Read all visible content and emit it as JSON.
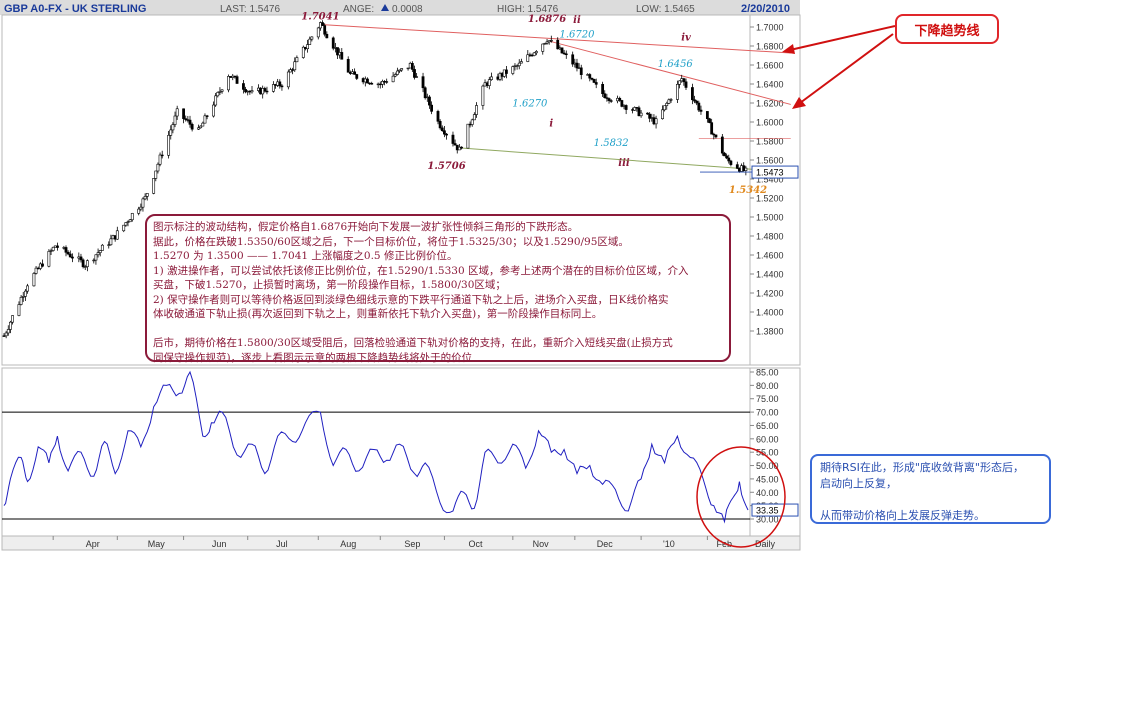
{
  "header": {
    "symbol": "GBP A0-FX - UK STERLING",
    "last": "LAST: 1.5476",
    "change_label": "ANGE:",
    "change_value": "0.0008",
    "high": "HIGH: 1.5476",
    "low": "LOW: 1.5465",
    "date": "2/20/2010"
  },
  "colors": {
    "candle": "#000000",
    "resistance_line": "#e06060",
    "support_line": "#90a860",
    "rsi_line": "#2020c0",
    "annotation_red": "#8b1a3a",
    "annotation_cyan": "#20a0c8",
    "circle": "#d01010"
  },
  "chart_data": [
    {
      "type": "candlestick",
      "title": "GBP A0-FX - UK STERLING",
      "x_months": [
        "Apr",
        "May",
        "Jun",
        "Jul",
        "Aug",
        "Sep",
        "Oct",
        "Nov",
        "Dec",
        "'10",
        "Feb",
        "Daily"
      ],
      "ylim": [
        1.36,
        1.71
      ],
      "y_ticks": [
        "1.7000",
        "1.6800",
        "1.6600",
        "1.6400",
        "1.6200",
        "1.6000",
        "1.5800",
        "1.5600",
        "1.5400",
        "1.5200",
        "1.5000",
        "1.4800",
        "1.4600",
        "1.4400",
        "1.4200",
        "1.4000",
        "1.3800"
      ],
      "last_value_label": "1.5473",
      "approx_close_path": [
        {
          "date": "2009-03-09",
          "value": 1.375
        },
        {
          "date": "2009-03-20",
          "value": 1.43
        },
        {
          "date": "2009-04-02",
          "value": 1.47
        },
        {
          "date": "2009-04-16",
          "value": 1.45
        },
        {
          "date": "2009-04-30",
          "value": 1.48
        },
        {
          "date": "2009-05-14",
          "value": 1.52
        },
        {
          "date": "2009-05-29",
          "value": 1.61
        },
        {
          "date": "2009-06-08",
          "value": 1.59
        },
        {
          "date": "2009-06-22",
          "value": 1.65
        },
        {
          "date": "2009-07-03",
          "value": 1.63
        },
        {
          "date": "2009-07-17",
          "value": 1.64
        },
        {
          "date": "2009-08-04",
          "value": 1.7041
        },
        {
          "date": "2009-08-18",
          "value": 1.65
        },
        {
          "date": "2009-09-01",
          "value": 1.64
        },
        {
          "date": "2009-09-15",
          "value": 1.66
        },
        {
          "date": "2009-09-28",
          "value": 1.6
        },
        {
          "date": "2009-10-08",
          "value": 1.5706
        },
        {
          "date": "2009-10-20",
          "value": 1.64
        },
        {
          "date": "2009-11-05",
          "value": 1.66
        },
        {
          "date": "2009-11-18",
          "value": 1.6876
        },
        {
          "date": "2009-12-01",
          "value": 1.66
        },
        {
          "date": "2009-12-14",
          "value": 1.63
        },
        {
          "date": "2009-12-31",
          "value": 1.61
        },
        {
          "date": "2010-01-08",
          "value": 1.6
        },
        {
          "date": "2010-01-20",
          "value": 1.6456
        },
        {
          "date": "2010-02-01",
          "value": 1.6
        },
        {
          "date": "2010-02-10",
          "value": 1.56
        },
        {
          "date": "2010-02-19",
          "value": 1.5476
        }
      ],
      "annotations": [
        {
          "text": "1.7041",
          "date": "2009-08-04",
          "value": 1.708,
          "color": "red"
        },
        {
          "text": "1.6876",
          "date": "2009-11-18",
          "value": 1.7055,
          "color": "red"
        },
        {
          "text": "ii",
          "date": "2009-12-02",
          "value": 1.704,
          "color": "red"
        },
        {
          "text": "1.6720",
          "date": "2009-12-02",
          "value": 1.689,
          "color": "cyan"
        },
        {
          "text": "iv",
          "date": "2010-01-22",
          "value": 1.686,
          "color": "red"
        },
        {
          "text": "1.6456",
          "date": "2010-01-17",
          "value": 1.658,
          "color": "cyan"
        },
        {
          "text": "1.6270",
          "date": "2009-11-10",
          "value": 1.6165,
          "color": "cyan"
        },
        {
          "text": "i",
          "date": "2009-11-20",
          "value": 1.5955,
          "color": "red"
        },
        {
          "text": "1.5832",
          "date": "2009-12-18",
          "value": 1.5745,
          "color": "cyan"
        },
        {
          "text": "iii",
          "date": "2009-12-24",
          "value": 1.5535,
          "color": "red"
        },
        {
          "text": "1.5706",
          "date": "2009-10-02",
          "value": 1.5505,
          "color": "red"
        },
        {
          "text": "1.5342",
          "date": "2010-02-20",
          "value": 1.5255,
          "color": "orange"
        }
      ],
      "trendlines": [
        {
          "kind": "resistance",
          "from": {
            "date": "2009-08-05",
            "value": 1.7025
          },
          "to": {
            "date": "2010-03-12",
            "value": 1.6726
          }
        },
        {
          "kind": "resistance",
          "from": {
            "date": "2009-11-19",
            "value": 1.6852
          },
          "to": {
            "date": "2010-03-12",
            "value": 1.6185
          }
        },
        {
          "kind": "horizontal",
          "from": {
            "date": "2010-01-28",
            "value": 1.5827
          },
          "to": {
            "date": "2010-03-12",
            "value": 1.5827
          }
        },
        {
          "kind": "support",
          "from": {
            "date": "2009-10-08",
            "value": 1.5727
          },
          "to": {
            "date": "2010-02-25",
            "value": 1.5498
          }
        }
      ]
    },
    {
      "type": "line",
      "title": "RSI",
      "ylim": [
        24,
        86
      ],
      "y_ticks": [
        "85.00",
        "80.00",
        "75.00",
        "70.00",
        "65.00",
        "60.00",
        "55.00",
        "50.00",
        "45.00",
        "40.00",
        "35.00",
        "30.00"
      ],
      "reference_lines": [
        70,
        30
      ],
      "last_value_label": "33.35",
      "series": [
        {
          "points": [
            {
              "date": "2009-03-09",
              "value": 35
            },
            {
              "date": "2009-03-12",
              "value": 45
            },
            {
              "date": "2009-03-17",
              "value": 53
            },
            {
              "date": "2009-03-20",
              "value": 44
            },
            {
              "date": "2009-03-25",
              "value": 57
            },
            {
              "date": "2009-03-30",
              "value": 51
            },
            {
              "date": "2009-04-03",
              "value": 61
            },
            {
              "date": "2009-04-08",
              "value": 48
            },
            {
              "date": "2009-04-14",
              "value": 55
            },
            {
              "date": "2009-04-20",
              "value": 46
            },
            {
              "date": "2009-04-25",
              "value": 59
            },
            {
              "date": "2009-04-30",
              "value": 47
            },
            {
              "date": "2009-05-06",
              "value": 63
            },
            {
              "date": "2009-05-12",
              "value": 57
            },
            {
              "date": "2009-05-18",
              "value": 72
            },
            {
              "date": "2009-05-24",
              "value": 80
            },
            {
              "date": "2009-05-30",
              "value": 77
            },
            {
              "date": "2009-06-04",
              "value": 85
            },
            {
              "date": "2009-06-10",
              "value": 61
            },
            {
              "date": "2009-06-14",
              "value": 66
            },
            {
              "date": "2009-06-19",
              "value": 70
            },
            {
              "date": "2009-06-26",
              "value": 54
            },
            {
              "date": "2009-07-03",
              "value": 58
            },
            {
              "date": "2009-07-09",
              "value": 47
            },
            {
              "date": "2009-07-15",
              "value": 61
            },
            {
              "date": "2009-07-22",
              "value": 59
            },
            {
              "date": "2009-07-28",
              "value": 66
            },
            {
              "date": "2009-08-04",
              "value": 70
            },
            {
              "date": "2009-08-10",
              "value": 50
            },
            {
              "date": "2009-08-16",
              "value": 56
            },
            {
              "date": "2009-08-22",
              "value": 48
            },
            {
              "date": "2009-08-29",
              "value": 56
            },
            {
              "date": "2009-09-04",
              "value": 52
            },
            {
              "date": "2009-09-10",
              "value": 58
            },
            {
              "date": "2009-09-17",
              "value": 47
            },
            {
              "date": "2009-09-22",
              "value": 51
            },
            {
              "date": "2009-09-29",
              "value": 36
            },
            {
              "date": "2009-10-05",
              "value": 33
            },
            {
              "date": "2009-10-10",
              "value": 40
            },
            {
              "date": "2009-10-15",
              "value": 34
            },
            {
              "date": "2009-10-20",
              "value": 55
            },
            {
              "date": "2009-10-26",
              "value": 51
            },
            {
              "date": "2009-11-02",
              "value": 58
            },
            {
              "date": "2009-11-08",
              "value": 49
            },
            {
              "date": "2009-11-14",
              "value": 63
            },
            {
              "date": "2009-11-20",
              "value": 55
            },
            {
              "date": "2009-11-26",
              "value": 56
            },
            {
              "date": "2009-12-02",
              "value": 47
            },
            {
              "date": "2009-12-08",
              "value": 50
            },
            {
              "date": "2009-12-14",
              "value": 43
            },
            {
              "date": "2009-12-20",
              "value": 41
            },
            {
              "date": "2009-12-26",
              "value": 33
            },
            {
              "date": "2010-01-01",
              "value": 45
            },
            {
              "date": "2010-01-06",
              "value": 58
            },
            {
              "date": "2010-01-12",
              "value": 51
            },
            {
              "date": "2010-01-18",
              "value": 61
            },
            {
              "date": "2010-01-24",
              "value": 53
            },
            {
              "date": "2010-01-30",
              "value": 45
            },
            {
              "date": "2010-02-04",
              "value": 35
            },
            {
              "date": "2010-02-09",
              "value": 29
            },
            {
              "date": "2010-02-13",
              "value": 38
            },
            {
              "date": "2010-02-16",
              "value": 44
            },
            {
              "date": "2010-02-20",
              "value": 33.35
            }
          ]
        }
      ]
    }
  ],
  "main_note": {
    "lines": [
      "图示标注的波动结构，假定价格自1.6876开始向下发展一波扩张性倾斜三角形的下跌形态。",
      "据此，价格在跌破1.5350/60区域之后，下一个目标价位，将位于1.5325/30；以及1.5290/95区域。",
      "1.5270 为 1.3500 —— 1.7041 上涨幅度之0.5 修正比例价位。",
      "1) 激进操作者，可以尝试依托该修正比例价位，在1.5290/1.5330 区域，参考上述两个潜在的目标价位区域，介入",
      "买盘，下破1.5270，止损暂时离场，第一阶段操作目标，1.5800/30区域；",
      "2) 保守操作者则可以等待价格返回到淡绿色细线示意的下跌平行通道下轨之上后，进场介入买盘，日K线价格实",
      "体收破通道下轨止损(再次返回到下轨之上，则重新依托下轨介入买盘)，第一阶段操作目标同上。",
      "",
      "后市，期待价格在1.5800/30区域受阻后，回落检验通道下轨对价格的支持，在此，重新介入短线买盘(止损方式",
      "同保守操作规范)，逐步上看图示示意的两根下降趋势线将处于的价位"
    ]
  },
  "rsi_note": {
    "lines": [
      "期待RSI在此，形成\"底收敛背离\"形态后，",
      "启动向上反复，",
      "",
      "从而带动价格向上发展反弹走势。"
    ]
  },
  "trend_label": "下降趋势线"
}
